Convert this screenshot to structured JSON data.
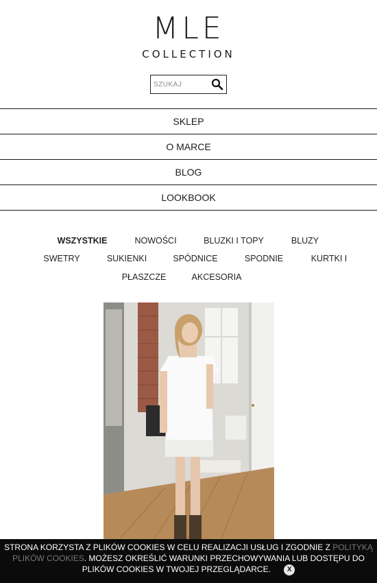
{
  "brand": {
    "name": "MLE",
    "sub": "COLLECTION"
  },
  "search": {
    "placeholder": "SZUKAJ",
    "icon": "search-icon"
  },
  "menu": [
    {
      "label": "SKLEP"
    },
    {
      "label": "O MARCE"
    },
    {
      "label": "BLOG"
    },
    {
      "label": "LOOKBOOK"
    }
  ],
  "categories": [
    {
      "label": "WSZYSTKIE",
      "active": true
    },
    {
      "label": "NOWOŚCI"
    },
    {
      "label": "BLUZKI I TOPY"
    },
    {
      "label": "BLUZY"
    },
    {
      "label": "SWETRY"
    },
    {
      "label": "SUKIENKI"
    },
    {
      "label": "SPÓDNICE"
    },
    {
      "label": "SPODNIE"
    },
    {
      "label": "KURTKI I"
    },
    {
      "label": "PŁASZCZE"
    },
    {
      "label": "AKCESORIA"
    }
  ],
  "cookie": {
    "text_before": "STRONA KORZYSTA Z PLIKÓW COOKIES W CELU REALIZACJI USŁUG I ZGODNIE Z ",
    "link": "POLITYKĄ PLIKÓW COOKIES",
    "text_after": ". MOŻESZ OKREŚLIĆ WARUNKI PRZECHOWYWANIA LUB DOSTĘPU DO PLIKÓW COOKIES W TWOJEJ PRZEGLĄDARCE.",
    "close": "X"
  }
}
